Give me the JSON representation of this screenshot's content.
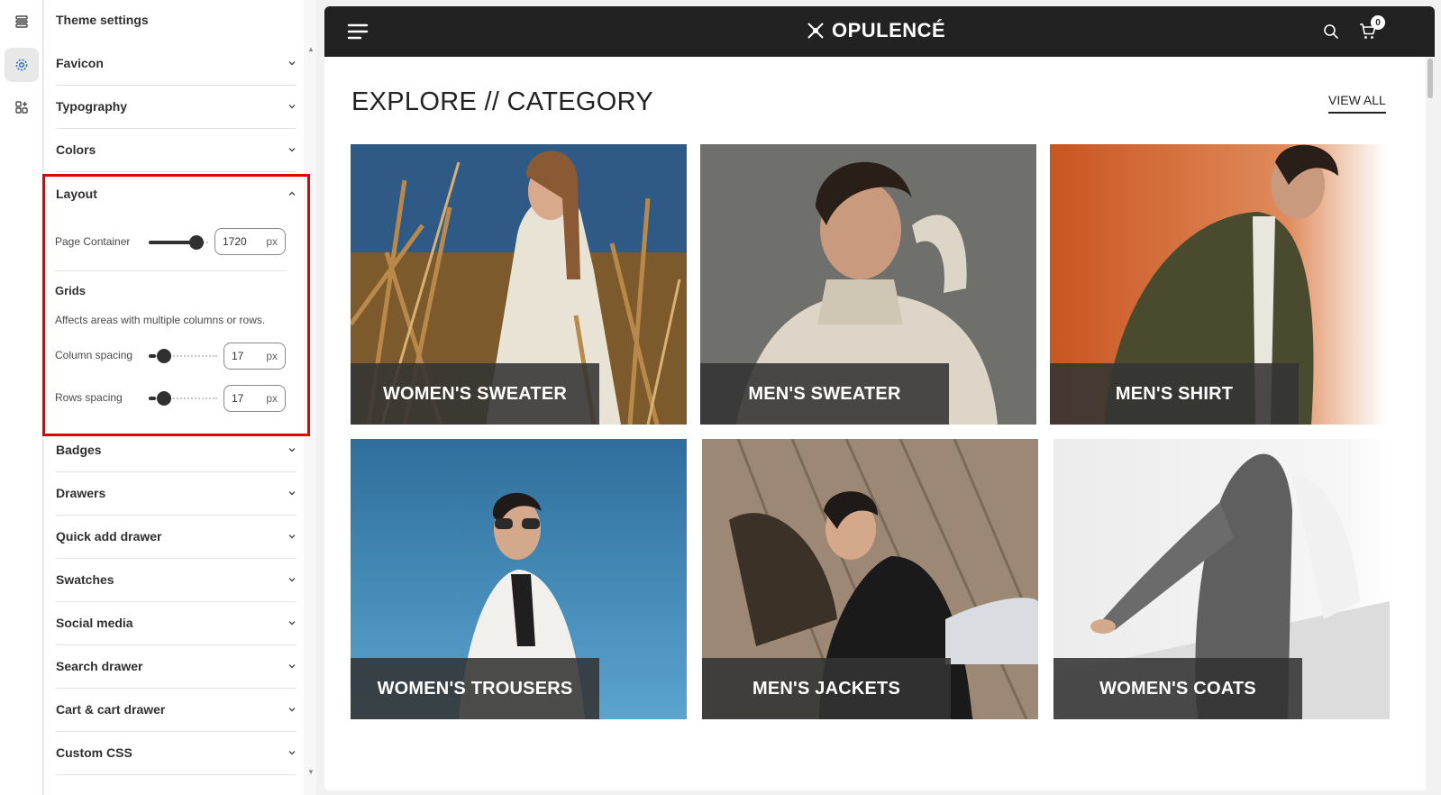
{
  "rail": {
    "icons": [
      "sections-icon",
      "gear-icon",
      "apps-icon"
    ]
  },
  "panel": {
    "title": "Theme settings",
    "sections_top": [
      {
        "label": "Favicon"
      },
      {
        "label": "Typography"
      },
      {
        "label": "Colors"
      }
    ],
    "layout": {
      "label": "Layout",
      "page_container_label": "Page Container",
      "page_container_value": "1720",
      "page_container_slider_level": 0.8,
      "unit": "px",
      "grids_heading": "Grids",
      "grids_help": "Affects areas with multiple columns or rows.",
      "column_spacing_label": "Column spacing",
      "column_spacing_value": "17",
      "column_spacing_slider_level": 0.1,
      "rows_spacing_label": "Rows spacing",
      "rows_spacing_value": "17",
      "rows_spacing_slider_level": 0.1
    },
    "sections_bottom": [
      {
        "label": "Badges"
      },
      {
        "label": "Drawers"
      },
      {
        "label": "Quick add drawer"
      },
      {
        "label": "Swatches"
      },
      {
        "label": "Social media"
      },
      {
        "label": "Search drawer"
      },
      {
        "label": "Cart & cart drawer"
      },
      {
        "label": "Custom CSS"
      }
    ]
  },
  "store": {
    "brand": "OPULENCÉ",
    "cart_count": "0",
    "section_title": "EXPLORE // CATEGORY",
    "view_all": "VIEW ALL",
    "categories": [
      {
        "label": "WOMEN'S SWEATER"
      },
      {
        "label": "MEN'S SWEATER"
      },
      {
        "label": "MEN'S SHIRT"
      },
      {
        "label": "WOMEN'S TROUSERS"
      },
      {
        "label": "MEN'S JACKETS"
      },
      {
        "label": "WOMEN'S COATS"
      }
    ]
  },
  "colors": {
    "header_bg": "#222222",
    "highlight": "#e50000",
    "label_overlay": "#333333"
  }
}
